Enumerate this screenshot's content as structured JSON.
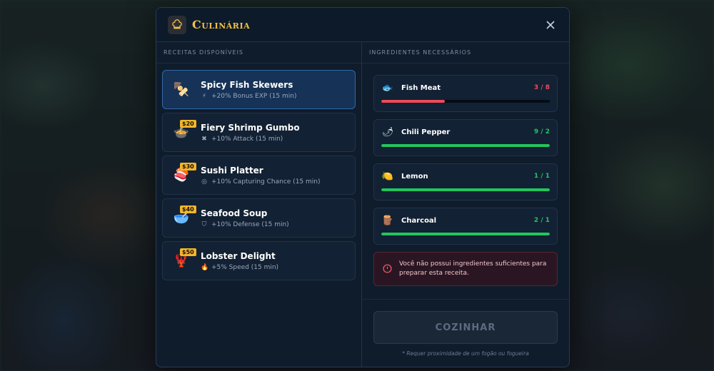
{
  "modal": {
    "title": "Culinária",
    "close_icon": "close-icon",
    "header_icon": "chef-hat-icon"
  },
  "recipes_panel": {
    "label": "RECEITAS DISPONÍVEIS",
    "items": [
      {
        "name": "Spicy Fish Skewers",
        "bonus": "+20% Bonus EXP (15 min)",
        "price": "",
        "icon": "🍢",
        "bonus_icon": "⚡",
        "selected": true
      },
      {
        "name": "Fiery Shrimp Gumbo",
        "bonus": "+10% Attack (15 min)",
        "price": "$20",
        "icon": "🍲",
        "bonus_icon": "✖",
        "selected": false
      },
      {
        "name": "Sushi Platter",
        "bonus": "+10% Capturing Chance (15 min)",
        "price": "$30",
        "icon": "🍣",
        "bonus_icon": "◎",
        "selected": false
      },
      {
        "name": "Seafood Soup",
        "bonus": "+10% Defense (15 min)",
        "price": "$40",
        "icon": "🥣",
        "bonus_icon": "⛉",
        "selected": false
      },
      {
        "name": "Lobster Delight",
        "bonus": "+5% Speed (15 min)",
        "price": "$50",
        "icon": "🦞",
        "bonus_icon": "🔥",
        "selected": false
      }
    ]
  },
  "ingredients_panel": {
    "label": "INGREDIENTES NECESSÁRIOS",
    "items": [
      {
        "name": "Fish Meat",
        "count": "3 / 8",
        "progress": 0.375,
        "icon": "🐟",
        "color": "#ef4b5a"
      },
      {
        "name": "Chili Pepper",
        "count": "9 / 2",
        "progress": 1.0,
        "icon": "🌶",
        "color": "#22c55e"
      },
      {
        "name": "Lemon",
        "count": "1 / 1",
        "progress": 1.0,
        "icon": "🍋",
        "color": "#22c55e"
      },
      {
        "name": "Charcoal",
        "count": "2 / 1",
        "progress": 1.0,
        "icon": "🪵",
        "color": "#22c55e"
      }
    ],
    "warning": "Você não possui ingredientes suficientes para preparar esta receita.",
    "warning_icon": "alert-circle-icon",
    "cook_button": "COZINHAR",
    "footnote": "* Requer proximidade de um fogão ou fogueira"
  }
}
